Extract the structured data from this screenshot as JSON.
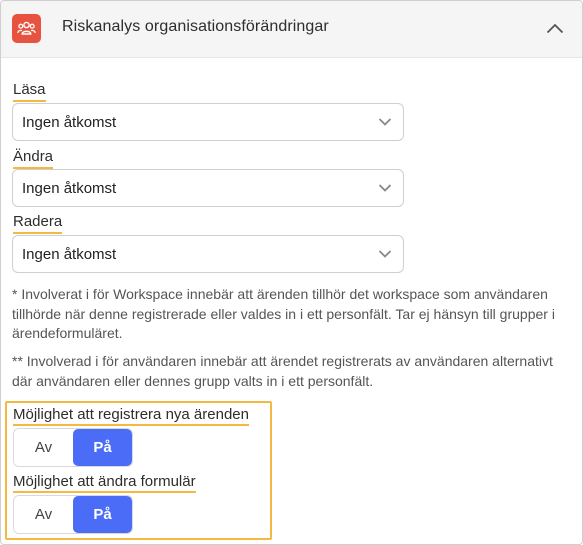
{
  "header": {
    "title": "Riskanalys organisationsförändringar",
    "icon": "group-icon",
    "icon_bg": "#e8533f",
    "collapse_icon": "chevron-up-icon"
  },
  "fields": [
    {
      "label": "Läsa",
      "value": "Ingen åtkomst"
    },
    {
      "label": "Ändra",
      "value": "Ingen åtkomst"
    },
    {
      "label": "Radera",
      "value": "Ingen åtkomst"
    }
  ],
  "notes": {
    "workspace": "* Involverat i för Workspace innebär att ärenden tillhör det workspace som användaren tillhörde när denne registrerade eller valdes in i ett personfält. Tar ej hänsyn till grupper i ärendeformuläret.",
    "user": "** Involverad i för användaren innebär att ärendet registrerats av användaren alternativt där användaren eller dennes grupp valts in i ett personfält."
  },
  "toggles": [
    {
      "label": "Möjlighet att registrera nya ärenden",
      "off_label": "Av",
      "on_label": "På",
      "selected": "on"
    },
    {
      "label": "Möjlighet att ändra formulär",
      "off_label": "Av",
      "on_label": "På",
      "selected": "on"
    }
  ],
  "colors": {
    "accent": "#4a6cf7",
    "highlight": "#f4b942"
  }
}
